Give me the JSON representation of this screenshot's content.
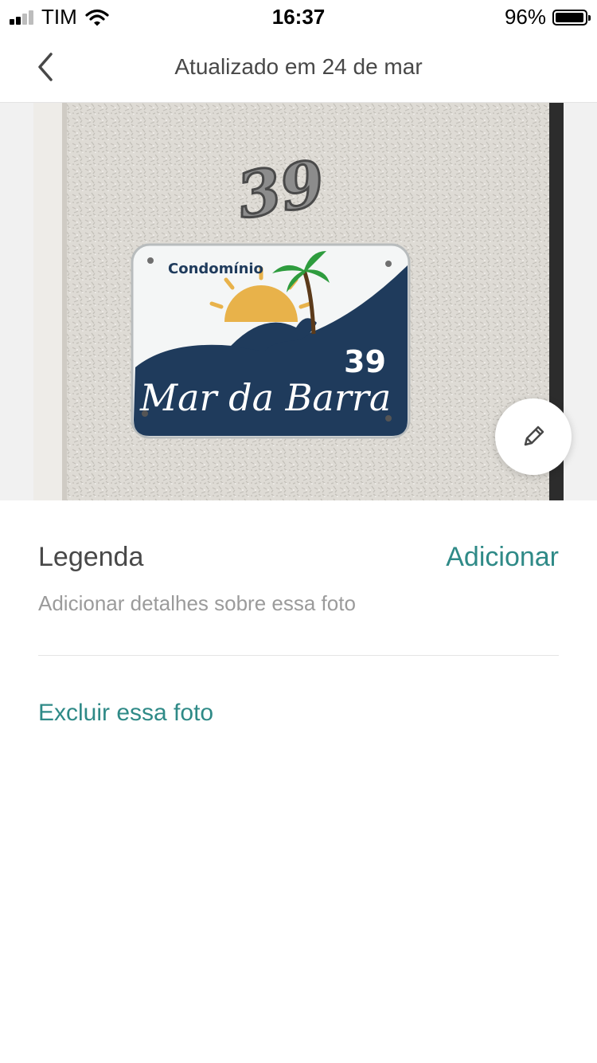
{
  "status_bar": {
    "carrier": "TIM",
    "time": "16:37",
    "battery": "96%",
    "battery_level": 0.96
  },
  "header": {
    "back_icon": "chevron-left-icon",
    "title": "Atualizado em 24 de mar"
  },
  "photo": {
    "house_number": "39",
    "sign_prefix": "Condomínio",
    "sign_name": "Mar da Barra",
    "sign_number": "39",
    "edit_icon": "pencil-icon"
  },
  "caption": {
    "label": "Legenda",
    "action": "Adicionar",
    "placeholder": "Adicionar detalhes sobre essa foto"
  },
  "delete": {
    "label": "Excluir essa foto"
  },
  "colors": {
    "accent": "#2f8a87",
    "text": "#484848",
    "muted": "#9b9b9b",
    "sign_navy": "#1f3b5c"
  }
}
